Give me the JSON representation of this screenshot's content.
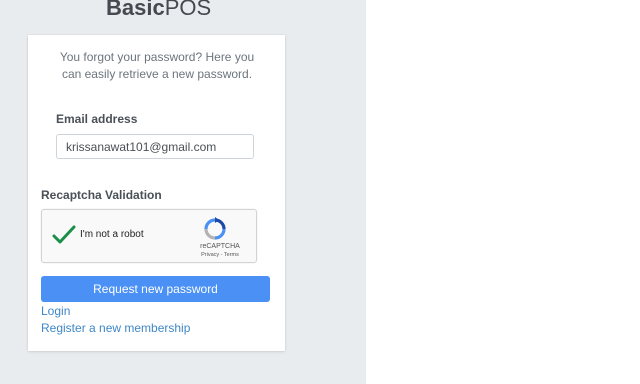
{
  "brand": {
    "logo_bold": "Basic",
    "logo_light": "POS"
  },
  "card": {
    "message_line1": "You forgot your password? Here you",
    "message_line2": "can easily retrieve a new password."
  },
  "form": {
    "email_label": "Email address",
    "email_value": "krissanawat101@gmail.com",
    "recaptcha_label": "Recaptcha Validation",
    "recaptcha": {
      "checkbox_text": "I'm not a robot",
      "checked": true,
      "brand": "reCAPTCHA",
      "terms": "Privacy - Terms",
      "check_color": "#1a8f48"
    },
    "submit_label": "Request new password"
  },
  "links": {
    "login": "Login",
    "register": "Register a new membership"
  },
  "colors": {
    "background_left": "#e9ecef",
    "primary": "#4a90f5",
    "link": "#3f87c6"
  }
}
